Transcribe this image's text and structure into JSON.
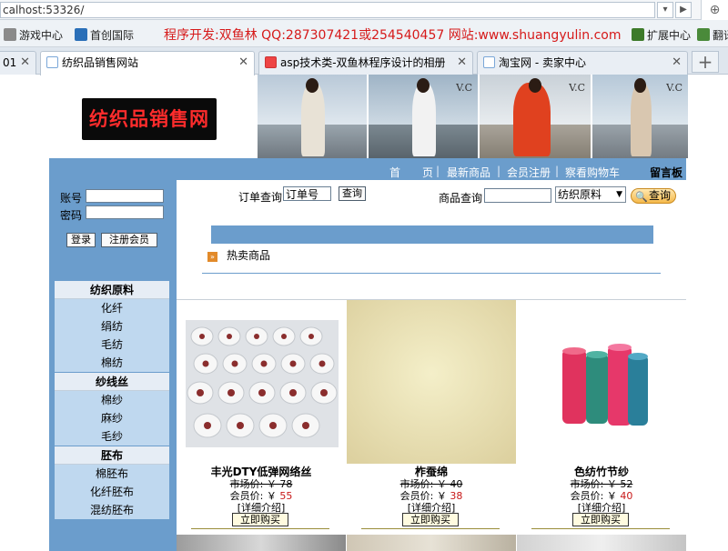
{
  "browser": {
    "url": "calhost:53326/",
    "bookmarks": [
      {
        "label": "游戏中心"
      },
      {
        "label": "首创国际"
      }
    ],
    "promo": "程序开发:双鱼林 QQ:287307421或254540457 网站:www.shuangyulin.com",
    "ext_center": "扩展中心",
    "translate": "翻译",
    "tabs": [
      {
        "label": "01"
      },
      {
        "label": "纺织品销售网站"
      },
      {
        "label": "asp技术类-双鱼林程序设计的相册"
      },
      {
        "label": "淘宝网 - 卖家中心"
      }
    ]
  },
  "site": {
    "logo": "纺织品销售网",
    "photo_mark": "V.C",
    "nav": {
      "home": "首　　页",
      "new": "最新商品",
      "register": "会员注册",
      "cart": "察看购物车",
      "guestbook": "留言板"
    },
    "login": {
      "account_label": "账号",
      "password_label": "密码",
      "login_btn": "登录",
      "register_btn": "注册会员"
    },
    "categories": [
      {
        "title": "纺织原料",
        "items": [
          "化纤",
          "绢纺",
          "毛纺",
          "棉纺"
        ]
      },
      {
        "title": "纱线丝",
        "items": [
          "棉纱",
          "麻纱",
          "毛纱"
        ]
      },
      {
        "title": "胚布",
        "items": [
          "棉胚布",
          "化纤胚布",
          "混纺胚布"
        ]
      }
    ],
    "order_query": {
      "label": "订单查询",
      "value": "订单号",
      "btn": "查询"
    },
    "product_query": {
      "label": "商品查询",
      "select": "纺织原料",
      "btn": "查询"
    },
    "hot_label": "热卖商品",
    "products": [
      {
        "name": "丰光DTY低弹网络丝",
        "market": "市场价: ￥ 78",
        "member_prefix": "会员价: ￥ ",
        "member": "55",
        "detail": "[详细介绍]",
        "buy": "立即购买"
      },
      {
        "name": "柞蚕绵",
        "market": "市场价: ￥ 40",
        "member_prefix": "会员价: ￥ ",
        "member": "38",
        "detail": "[详细介绍]",
        "buy": "立即购买"
      },
      {
        "name": "色纺竹节纱",
        "market": "市场价: ￥ 52",
        "member_prefix": "会员价: ￥ ",
        "member": "40",
        "detail": "[详细介绍]",
        "buy": "立即购买"
      }
    ],
    "colors": {
      "frame": "#6b9dcc",
      "sidebar": "#bfd8ef",
      "price": "#c81717"
    }
  }
}
